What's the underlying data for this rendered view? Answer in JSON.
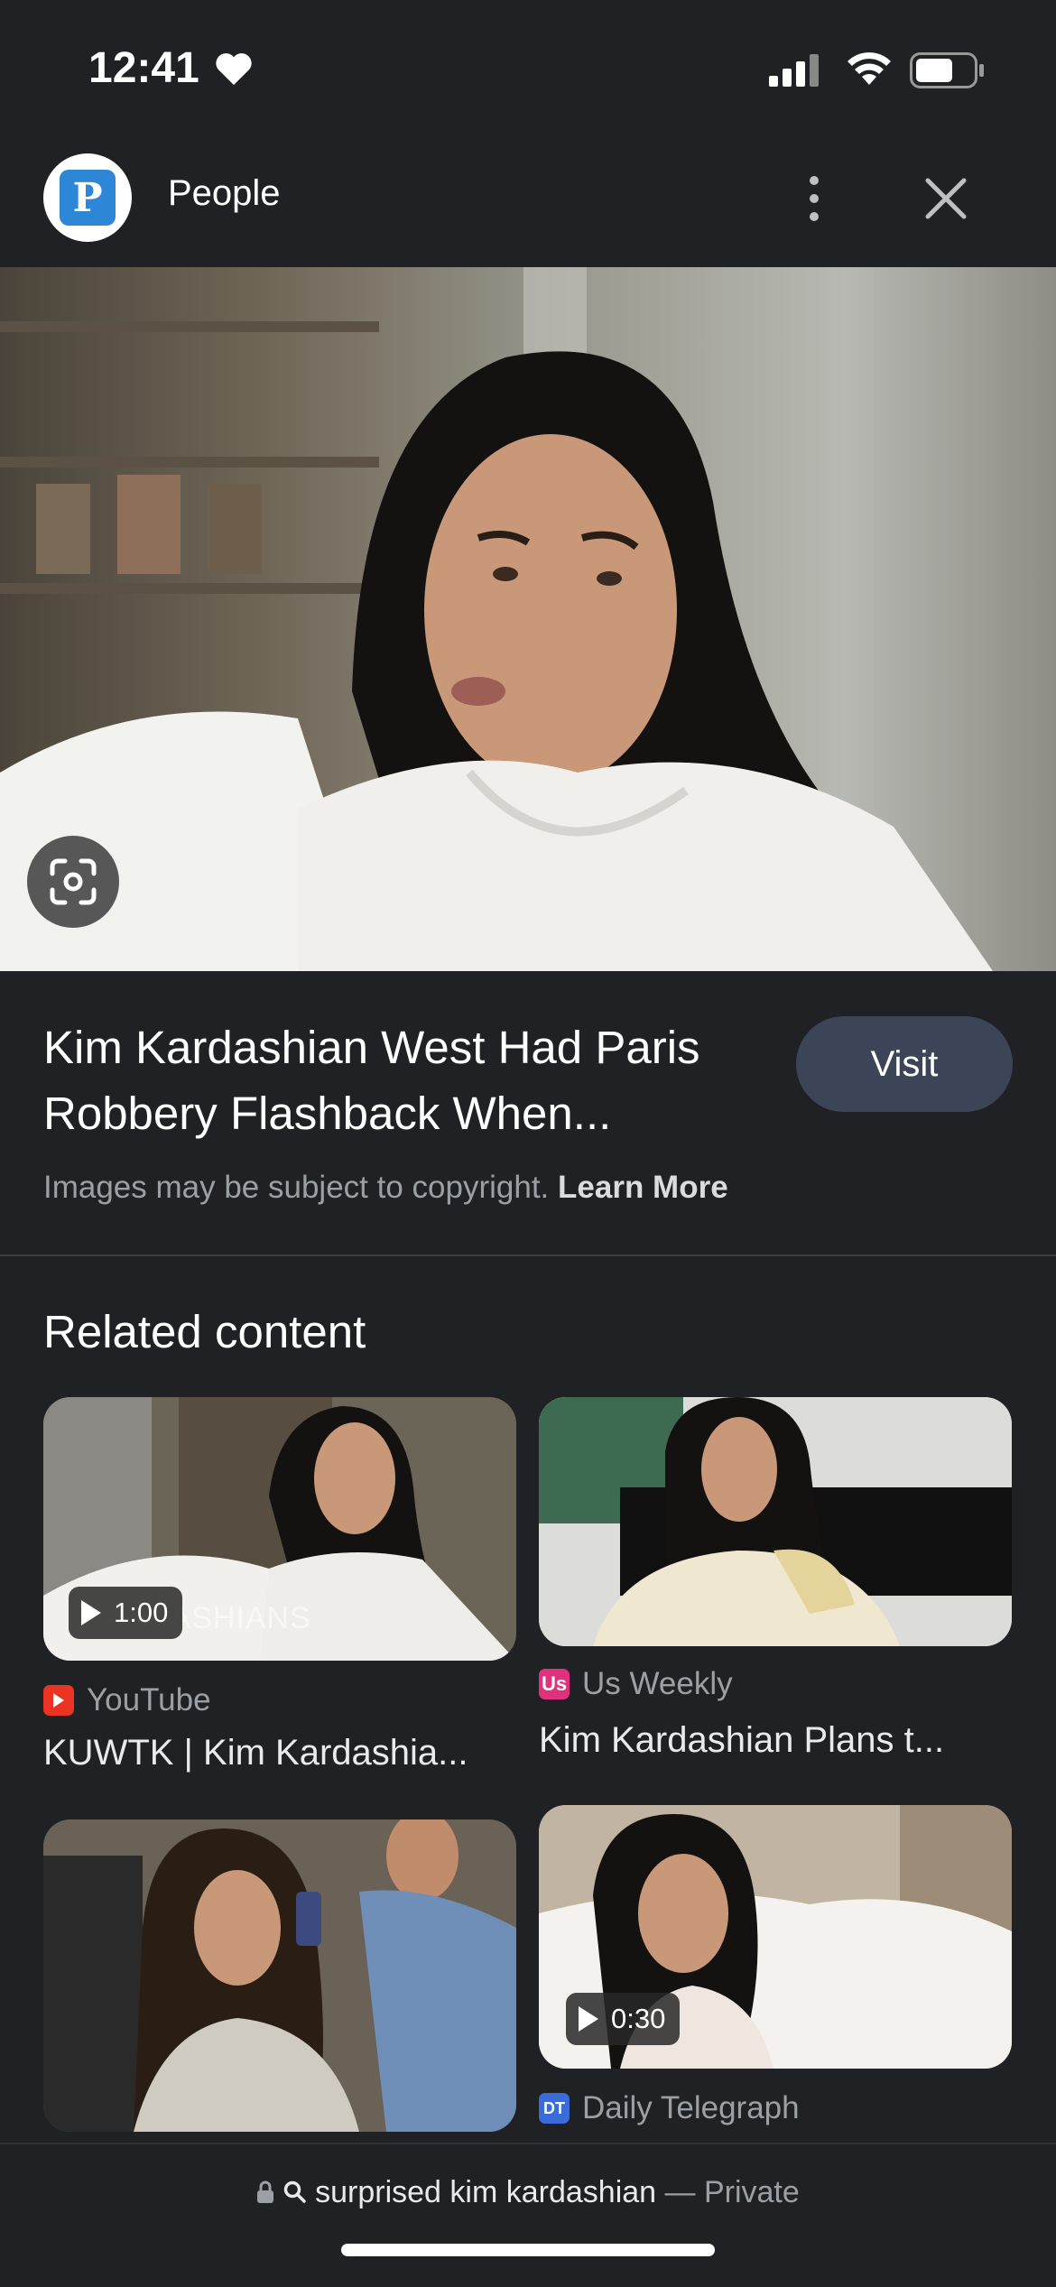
{
  "status_bar": {
    "time": "12:41"
  },
  "header": {
    "source_initial": "P",
    "source_name": "People"
  },
  "result": {
    "title": "Kim Kardashian West Had Paris Robbery Flashback When...",
    "visit_label": "Visit",
    "copyright_text": "Images may be subject to copyright.",
    "learn_more": "Learn More"
  },
  "related": {
    "heading": "Related content",
    "cards": [
      {
        "duration": "1:00",
        "watermark": "KARDASHIANS",
        "source": "YouTube",
        "title": "KUWTK | Kim Kardashia..."
      },
      {
        "source": "Us Weekly",
        "title": "Kim Kardashian Plans t..."
      },
      {
        "source": "",
        "title": ""
      },
      {
        "duration": "0:30",
        "source": "Daily Telegraph",
        "title": ""
      }
    ]
  },
  "search_bar": {
    "query": "surprised kim kardashian",
    "suffix": "— Private"
  },
  "colors": {
    "background": "#202124",
    "visit_button": "#3c4457",
    "youtube_red": "#ea3323",
    "usweekly_pink": "#e0317d",
    "telegraph_blue": "#3a6bd9"
  }
}
